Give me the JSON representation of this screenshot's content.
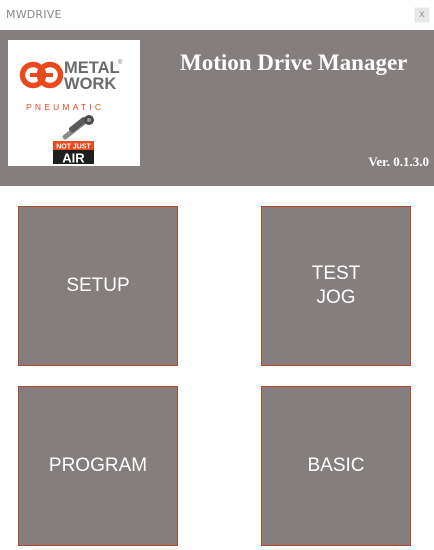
{
  "window": {
    "title": "MWDRIVE",
    "close_glyph": "x"
  },
  "header": {
    "app_title": "Motion Drive Manager",
    "version": "Ver. 0.1.3.0",
    "logo": {
      "line1": "METAL",
      "line2": "WORK",
      "registered": "®",
      "tagline": "PNEUMATIC",
      "badge_line1": "NOT JUST",
      "badge_line2": "AIR"
    }
  },
  "tiles": {
    "setup": "SETUP",
    "test_jog": "TEST\nJOG",
    "program": "PROGRAM",
    "basic": "BASIC"
  },
  "colors": {
    "panel_gray": "#847e7e",
    "tile_border": "#b2482b",
    "brand_orange": "#e8491d",
    "brand_gray": "#666666"
  }
}
